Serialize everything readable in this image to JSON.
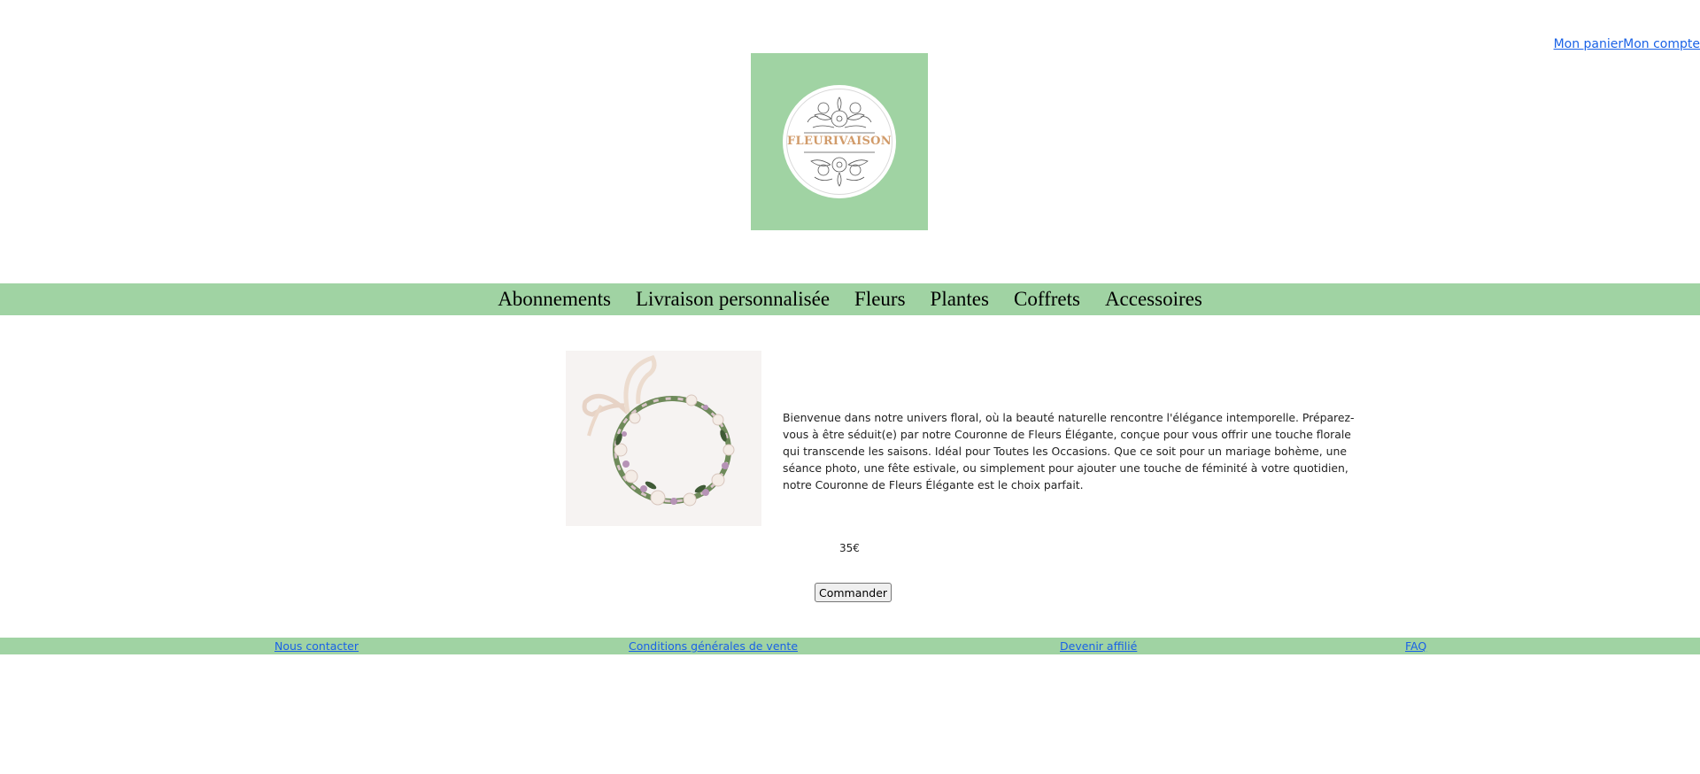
{
  "header": {
    "cart_link": "Mon panier",
    "account_link": "Mon compte",
    "logo_text": "FLEURIVAISON",
    "logo_color": "#a0d3a3"
  },
  "nav": {
    "items": [
      {
        "label": "Abonnements"
      },
      {
        "label": "Livraison personnalisée"
      },
      {
        "label": "Fleurs"
      },
      {
        "label": "Plantes"
      },
      {
        "label": "Coffrets"
      },
      {
        "label": "Accessoires"
      }
    ]
  },
  "product": {
    "image_icon": "flower-crown-image",
    "description": "Bienvenue dans notre univers floral, où la beauté naturelle rencontre l'élégance intemporelle. Préparez-vous à être séduit(e) par notre Couronne de Fleurs Élégante, conçue pour vous offrir une touche florale qui transcende les saisons. Idéal pour Toutes les Occasions. Que ce soit pour un mariage bohème, une séance photo, une fête estivale, ou simplement pour ajouter une touche de féminité à votre quotidien, notre Couronne de Fleurs Élégante est le choix parfait.",
    "price": "35€",
    "order_button": "Commander"
  },
  "footer": {
    "links": [
      {
        "label": "Nous contacter"
      },
      {
        "label": "Conditions générales de vente"
      },
      {
        "label": "Devenir affilié"
      },
      {
        "label": "FAQ"
      }
    ]
  }
}
